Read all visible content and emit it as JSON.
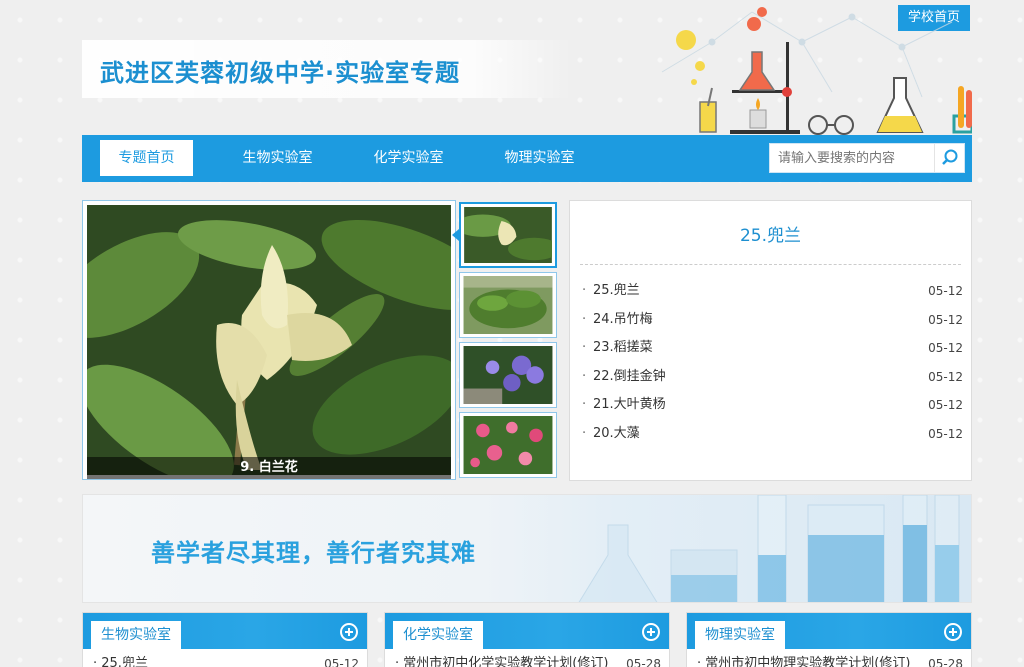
{
  "header": {
    "school_link": "学校首页",
    "title": "武进区芙蓉初级中学·实验室专题"
  },
  "nav": {
    "items": [
      {
        "label": "专题首页",
        "active": true
      },
      {
        "label": "生物实验室"
      },
      {
        "label": "化学实验室"
      },
      {
        "label": "物理实验室"
      }
    ],
    "search_placeholder": "请输入要搜索的内容"
  },
  "slideshow": {
    "caption": "9. 白兰花",
    "thumbnails": [
      "magnolia",
      "shrub",
      "hydrangea",
      "zinnia"
    ]
  },
  "news": {
    "headline": "25.兜兰",
    "items": [
      {
        "title": "25.兜兰",
        "date": "05-12"
      },
      {
        "title": "24.吊竹梅",
        "date": "05-12"
      },
      {
        "title": "23.稻搓菜",
        "date": "05-12"
      },
      {
        "title": "22.倒挂金钟",
        "date": "05-12"
      },
      {
        "title": "21.大叶黄杨",
        "date": "05-12"
      },
      {
        "title": "20.大藻",
        "date": "05-12"
      }
    ]
  },
  "banner": {
    "motto": "善学者尽其理，善行者究其难"
  },
  "columns": [
    {
      "title": "生物实验室",
      "first_item": "25.兜兰",
      "first_date": "05-12"
    },
    {
      "title": "化学实验室",
      "first_item": "常州市初中化学实验教学计划(修订)",
      "first_date": "05-28"
    },
    {
      "title": "物理实验室",
      "first_item": "常州市初中物理实验教学计划(修订)",
      "first_date": "05-28"
    }
  ],
  "colors": {
    "accent": "#1d9be0",
    "title": "#1b8fd0"
  }
}
